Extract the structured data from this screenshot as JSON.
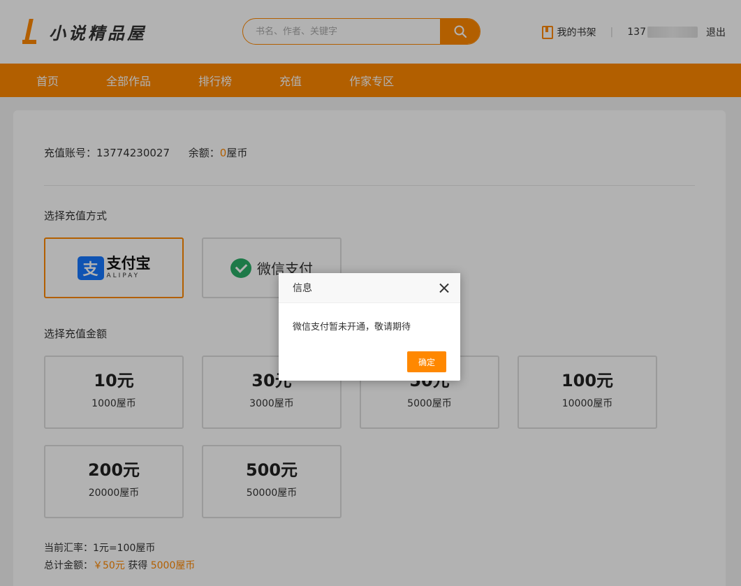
{
  "header": {
    "logo_text": "小说精品屋",
    "search_placeholder": "书名、作者、关键字",
    "bookshelf_label": "我的书架",
    "divider": "|",
    "user_phone_prefix": "137",
    "logout_label": "退出"
  },
  "nav": {
    "items": [
      "首页",
      "全部作品",
      "排行榜",
      "充值",
      "作家专区"
    ]
  },
  "account": {
    "label_account": "充值账号：",
    "account_number": "13774230027",
    "label_balance": "余额：",
    "balance": "0",
    "balance_unit": "屋币"
  },
  "pay_method": {
    "title": "选择充值方式",
    "alipay_cn": "支付宝",
    "alipay_en": "ALIPAY",
    "alipay_mark": "支",
    "wechat_label": "微信支付"
  },
  "amounts": {
    "title": "选择充值金额",
    "items": [
      {
        "yuan": "10元",
        "coins": "1000屋币"
      },
      {
        "yuan": "30元",
        "coins": "3000屋币"
      },
      {
        "yuan": "50元",
        "coins": "5000屋币"
      },
      {
        "yuan": "100元",
        "coins": "10000屋币"
      },
      {
        "yuan": "200元",
        "coins": "20000屋币"
      },
      {
        "yuan": "500元",
        "coins": "50000屋币"
      }
    ]
  },
  "summary": {
    "rate_label": "当前汇率：",
    "rate_value": "1元=100屋币",
    "total_label": "总计金额：",
    "total_value": "￥50元",
    "get_label": "获得",
    "get_value": "5000屋币"
  },
  "dialog": {
    "title": "信息",
    "message": "微信支付暂未开通，敬请期待",
    "confirm_label": "确定"
  },
  "colors": {
    "accent": "#ff8800",
    "alipay_blue": "#1678ff",
    "wechat_green": "#2aae67"
  }
}
